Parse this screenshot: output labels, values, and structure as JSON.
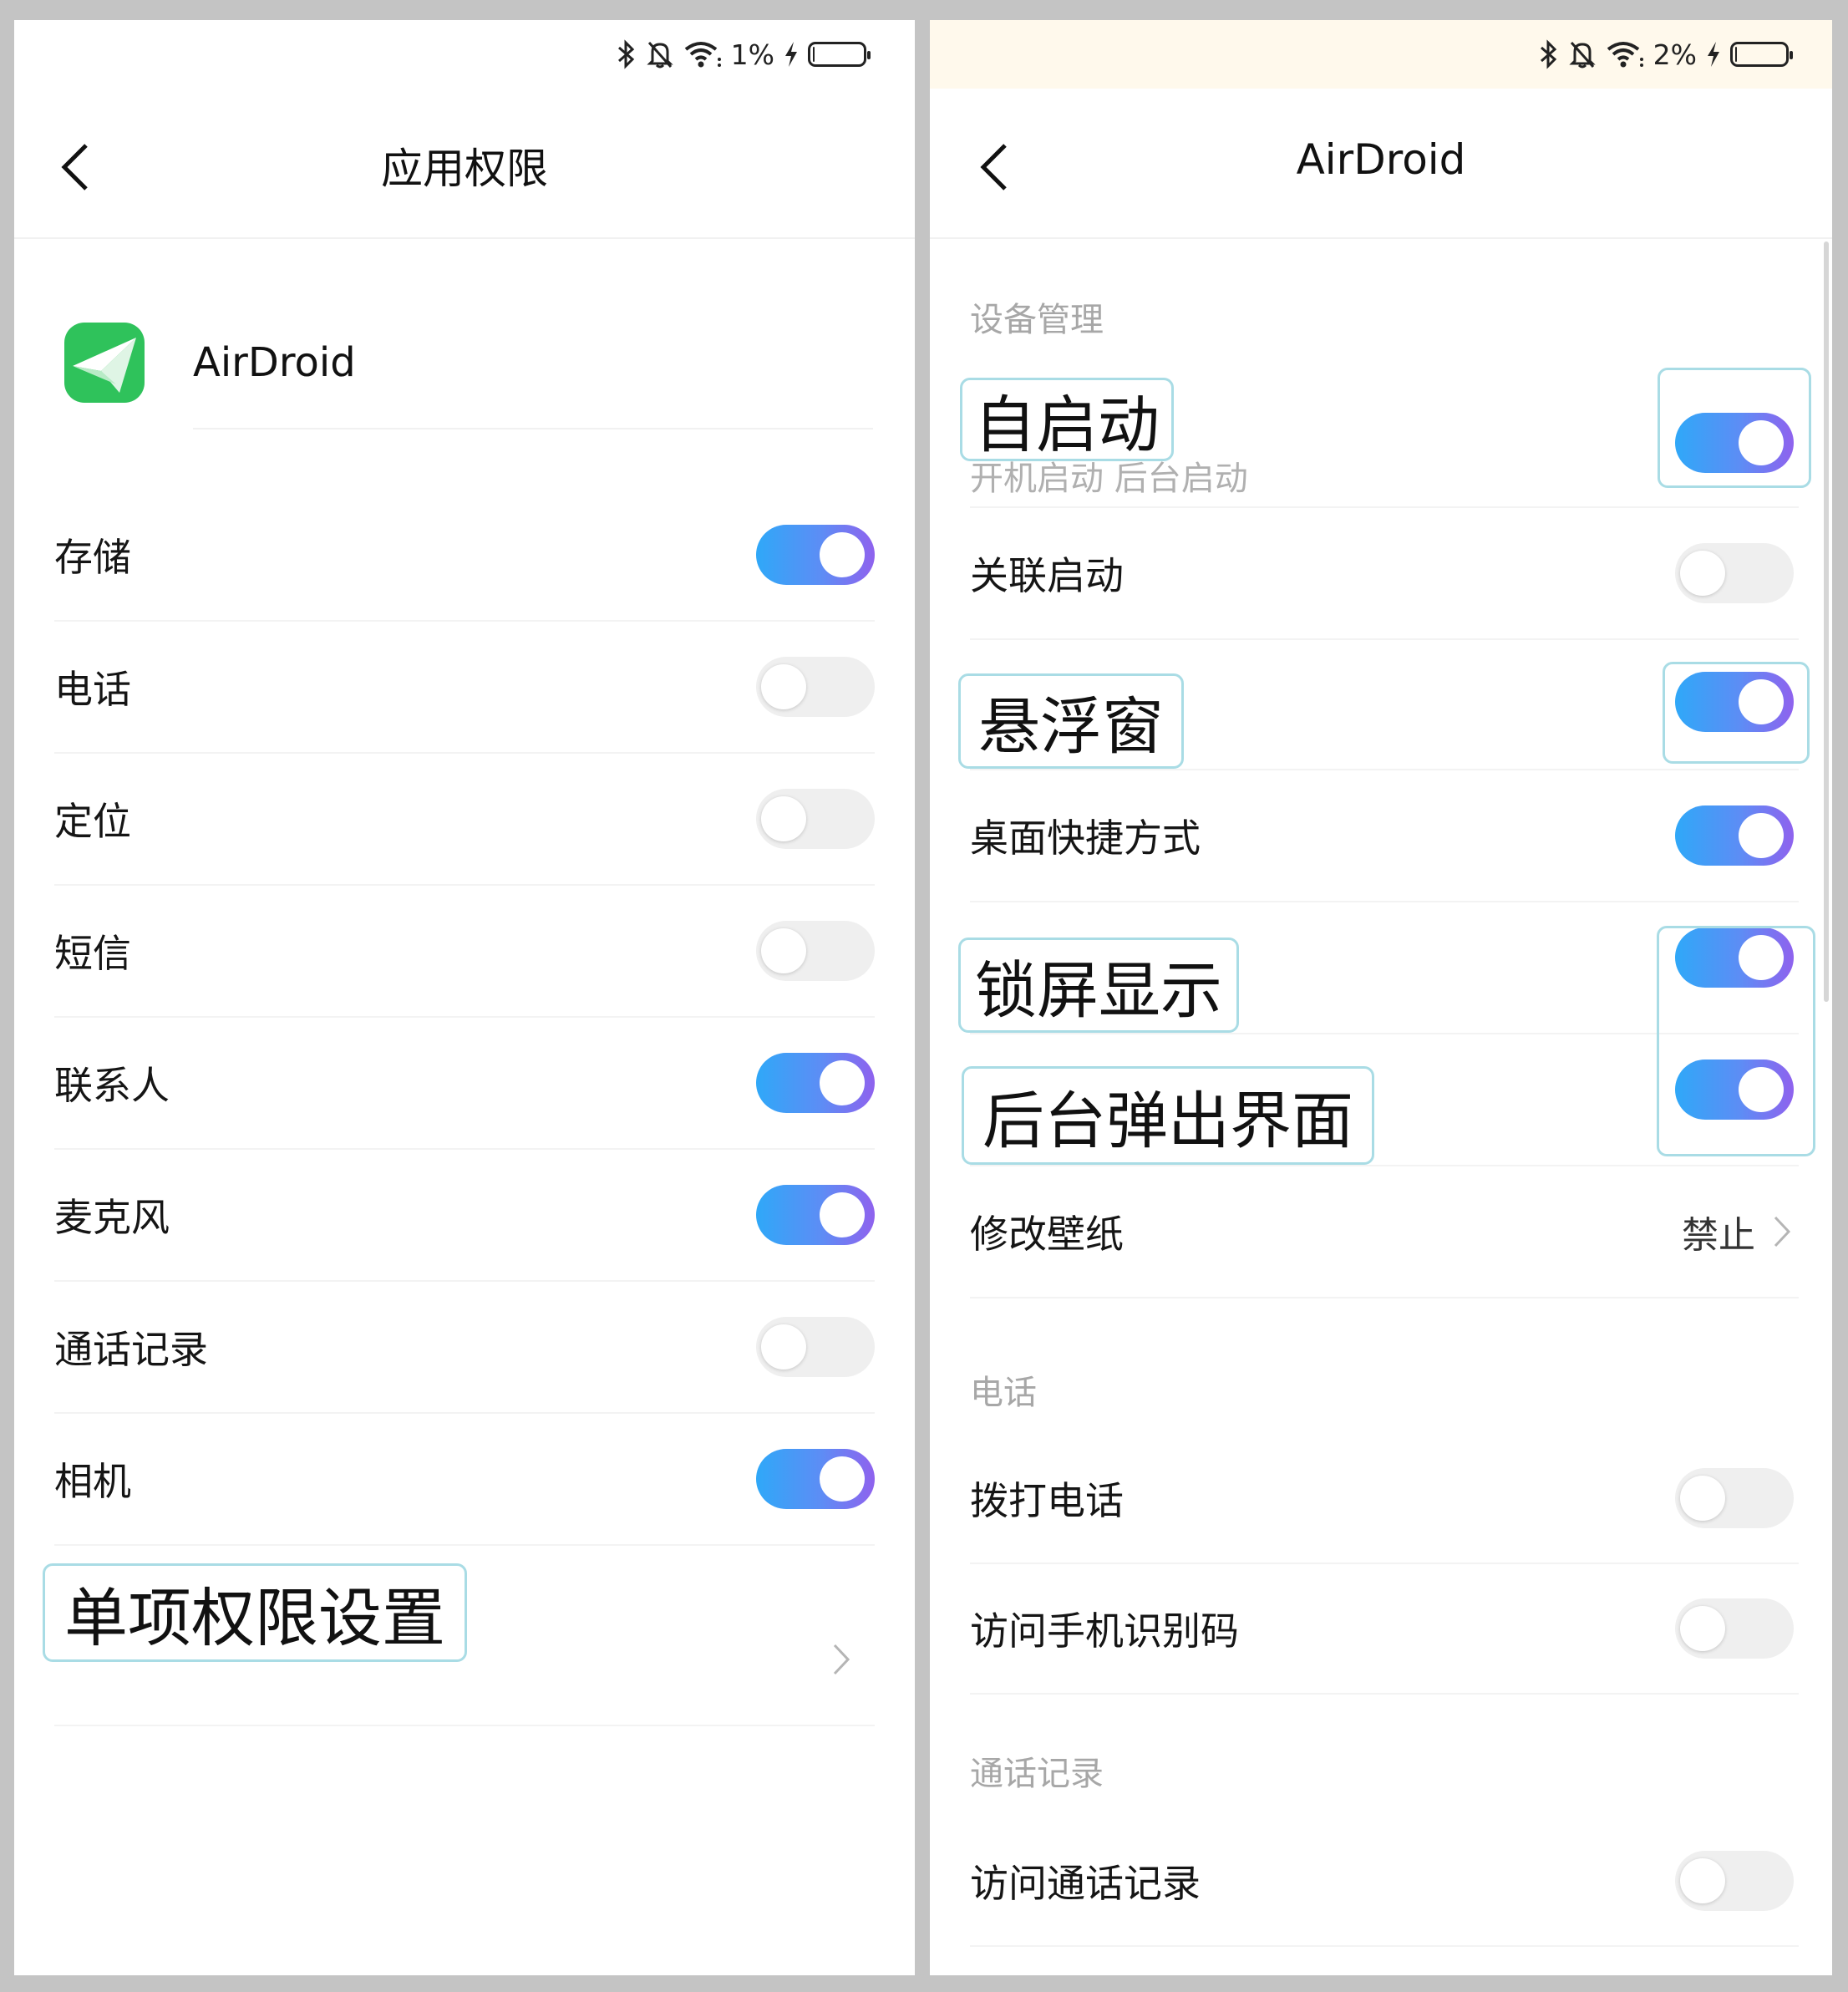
{
  "status_left": {
    "battery_text": "1%",
    "battery_level": 0.01
  },
  "status_right": {
    "battery_text": "2%",
    "battery_level": 0.02
  },
  "left": {
    "title": "应用权限",
    "app_name": "AirDroid",
    "permissions": [
      {
        "label": "存储",
        "on": true
      },
      {
        "label": "电话",
        "on": false
      },
      {
        "label": "定位",
        "on": false
      },
      {
        "label": "短信",
        "on": false
      },
      {
        "label": "联系人",
        "on": true
      },
      {
        "label": "麦克风",
        "on": true
      },
      {
        "label": "通话记录",
        "on": false
      },
      {
        "label": "相机",
        "on": true
      }
    ],
    "single_perm_label": "单项权限设置"
  },
  "right": {
    "title": "AirDroid",
    "sections": {
      "device": "设备管理",
      "phone": "电话",
      "calllog": "通话记录"
    },
    "rows": {
      "autostart": {
        "label": "自启动",
        "sub": "开机启动 后台启动",
        "on": true
      },
      "assoc": {
        "label": "关联启动",
        "on": false
      },
      "float": {
        "label": "悬浮窗",
        "on": true
      },
      "shortcut": {
        "label": "桌面快捷方式",
        "on": true
      },
      "lockscreen": {
        "label": "锁屏显示",
        "on": true
      },
      "bgpopup": {
        "label": "后台弹出界面",
        "on": true
      },
      "wallpaper": {
        "label": "修改壁纸",
        "value": "禁止"
      },
      "dial": {
        "label": "拨打电话",
        "on": false
      },
      "imei": {
        "label": "访问手机识别码",
        "on": false
      },
      "calllog_access": {
        "label": "访问通话记录",
        "on": false
      }
    }
  },
  "colors": {
    "toggle_on_start": "#2fa8f8",
    "toggle_on_end": "#8f62ee",
    "toggle_off": "#efefef",
    "callout_border": "#a9dce5",
    "app_icon": "#2fc25b"
  }
}
